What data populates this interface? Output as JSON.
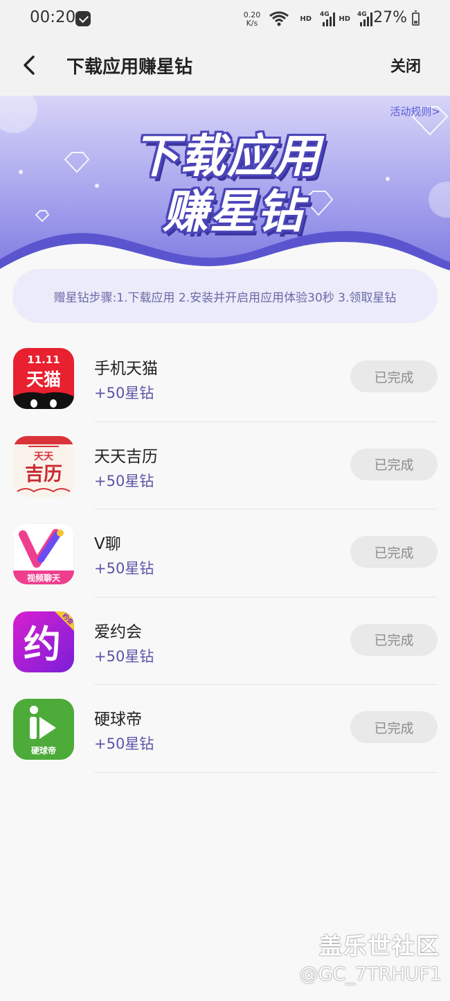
{
  "status_bar": {
    "time": "00:20",
    "net_speed_value": "0.20",
    "net_speed_unit": "K/s",
    "hd_label_1": "HD",
    "hd_label_2": "HD",
    "network_type": "4G",
    "battery": "27%"
  },
  "header": {
    "title": "下载应用赚星钻",
    "close_label": "关闭"
  },
  "banner": {
    "title_line1": "下载应用",
    "title_line2": "赚星钻",
    "rules_link": "活动规则>"
  },
  "steps": {
    "text": "赠星钻步骤:1.下载应用 2.安装并开启用应用体验30秒 3.领取星钻"
  },
  "apps": [
    {
      "name": "手机天猫",
      "reward": "+50星钻",
      "status": "已完成",
      "icon": "tmall-app-icon",
      "icon_text_top": "11.11",
      "icon_text_main": "天猫"
    },
    {
      "name": "天天吉历",
      "reward": "+50星钻",
      "status": "已完成",
      "icon": "calendar-app-icon",
      "icon_text_top": "天天",
      "icon_text_main": "吉历"
    },
    {
      "name": "V聊",
      "reward": "+50星钻",
      "status": "已完成",
      "icon": "vchat-app-icon",
      "icon_text_main": "视频聊天"
    },
    {
      "name": "爱约会",
      "reward": "+50星钻",
      "status": "已完成",
      "icon": "dating-app-icon",
      "icon_text_top": "约会",
      "icon_text_main": "约"
    },
    {
      "name": "硬球帝",
      "reward": "+50星钻",
      "status": "已完成",
      "icon": "hardball-app-icon",
      "icon_text_main": "硬球帝"
    }
  ],
  "watermark": {
    "brand": "盖乐世社区",
    "user": "@GC_7TRHUF1"
  },
  "colors": {
    "accent": "#5a55a8",
    "banner_purple": "#7b78e0",
    "steps_bg": "#ebebfa",
    "button_bg": "#e9e9e9"
  }
}
